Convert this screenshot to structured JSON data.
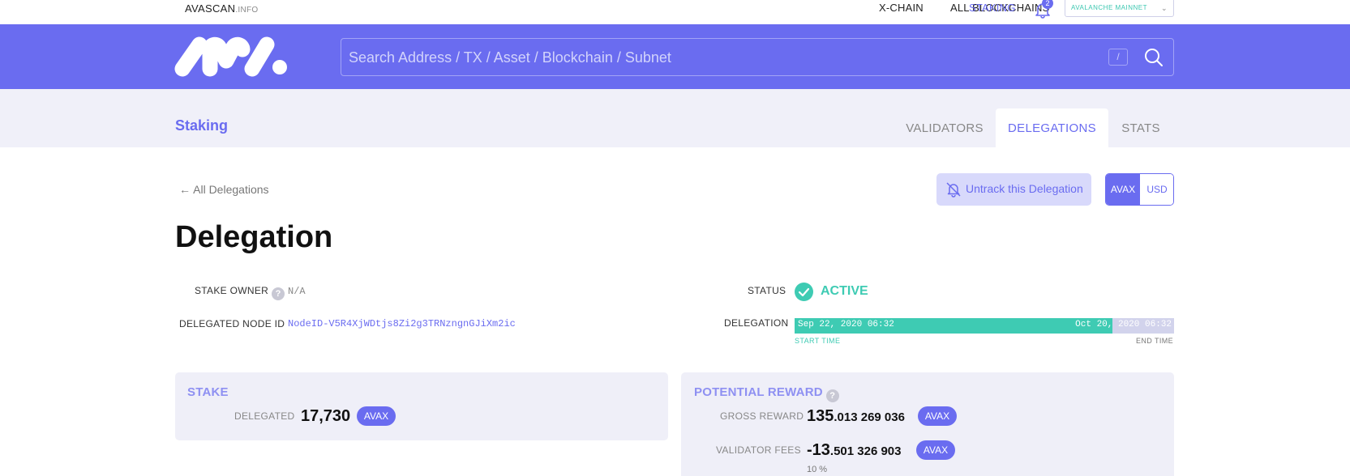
{
  "topbar": {
    "brand": "AVASCAN",
    "brand_suffix": ".INFO",
    "nav": [
      "X-CHAIN",
      "ALL BLOCKCHAINS",
      "STAKING"
    ],
    "active_nav": "STAKING",
    "notification_count": "2",
    "network": "AVALANCHE MAINNET",
    "bell_icon": "bell-icon",
    "network_icon": "chevron-down-icon"
  },
  "header": {
    "logo_icon": "avascan-logo-icon",
    "search_placeholder": "Search Address / TX / Asset / Blockchain / Subnet",
    "shortcut_key": "/",
    "search_icon": "search-icon"
  },
  "subheader": {
    "title": "Staking",
    "tabs": [
      "VALIDATORS",
      "DELEGATIONS",
      "STATS"
    ],
    "active_tab": "DELEGATIONS"
  },
  "content": {
    "back_label": "All Delegations",
    "back_icon": "arrow-left-icon",
    "untrack_label": "Untrack this Delegation",
    "untrack_icon": "bell-off-icon",
    "currency": [
      "AVAX",
      "USD"
    ],
    "active_currency": "AVAX",
    "title": "Delegation",
    "stake_owner_label": "STAKE OWNER",
    "stake_owner_value": "N/A",
    "node_id_label": "DELEGATED NODE ID",
    "node_id_value": "NodeID-V5R4XjWDtjs8Zi2g3TRNzngnGJiXm2ic",
    "status_label": "STATUS",
    "status_value": "ACTIVE",
    "status_icon": "check-circle-icon",
    "delegation_label": "DELEGATION",
    "start_date": "Sep 22, 2020 06:32",
    "end_date": "Oct 20, 2020 06:32",
    "start_caption": "START TIME",
    "end_caption": "END TIME",
    "progress_fraction": 0.837,
    "help_glyph": "?"
  },
  "stake_card": {
    "title": "STAKE",
    "delegated_label": "DELEGATED",
    "delegated_value": "17,730",
    "unit": "AVAX"
  },
  "reward_card": {
    "title": "POTENTIAL REWARD",
    "gross_label": "GROSS REWARD",
    "gross_int": "135",
    "gross_dec": ".013 269 036",
    "fees_label": "VALIDATOR FEES",
    "fees_int": "-13",
    "fees_dec": ".501 326 903",
    "fees_pct": "10 %",
    "unit": "AVAX"
  },
  "colors": {
    "accent": "#6a6cf0",
    "success": "#3ecbb3",
    "band": "#f0f0f9"
  }
}
